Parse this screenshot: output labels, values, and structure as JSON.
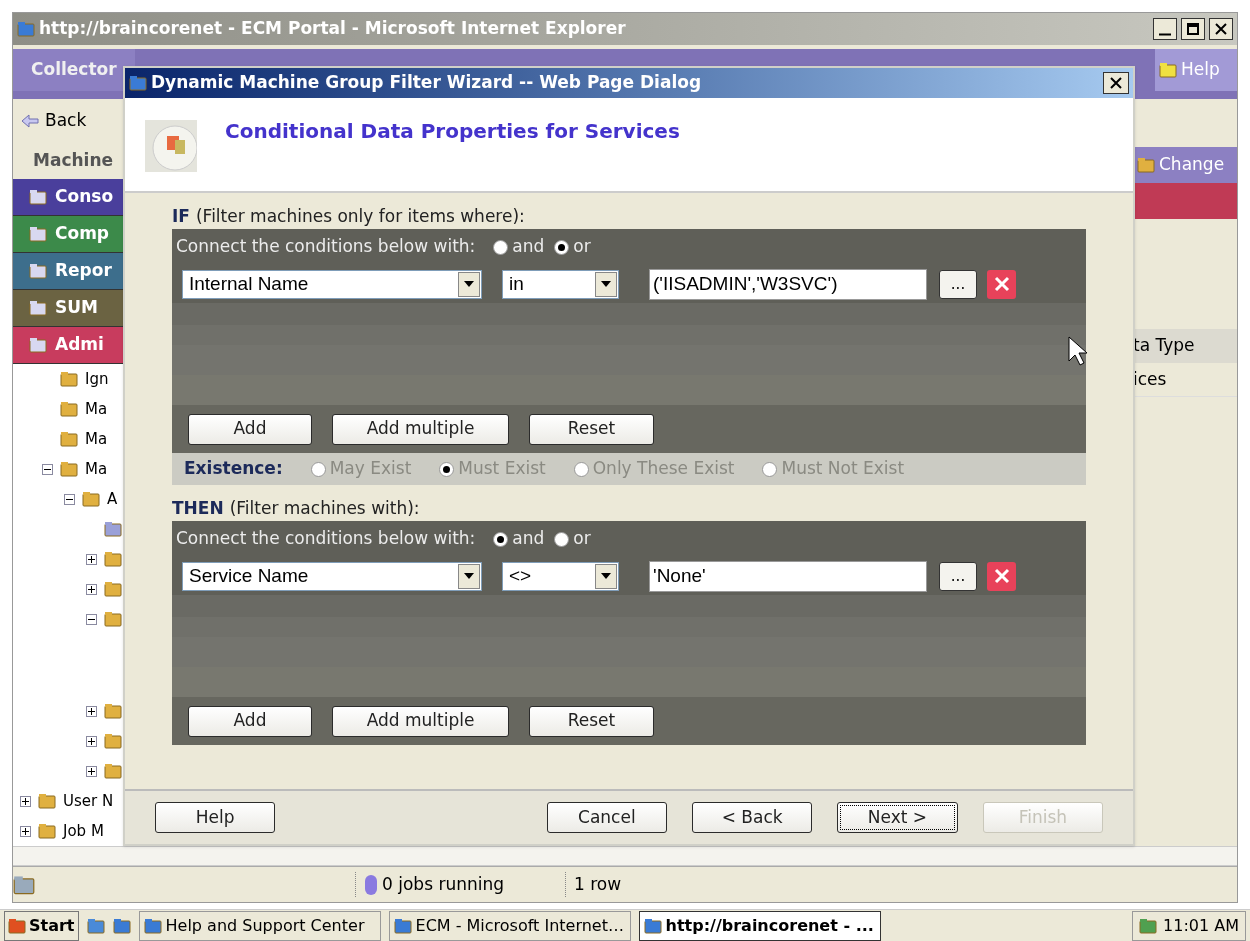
{
  "browser": {
    "title": "http://braincorenet - ECM Portal - Microsoft Internet Explorer"
  },
  "app": {
    "tab": "Collector",
    "help": "Help",
    "back": "Back",
    "section": "Machine",
    "nav": [
      {
        "label": "Conso",
        "color": "#4a3f9c"
      },
      {
        "label": "Comp",
        "color": "#3c8a4a"
      },
      {
        "label": "Repor",
        "color": "#3d6e8c"
      },
      {
        "label": "SUM",
        "color": "#6b6342"
      },
      {
        "label": "Admi",
        "color": "#c83c5e"
      }
    ],
    "tree": [
      {
        "label": "Ign"
      },
      {
        "label": "Ma"
      },
      {
        "label": "Ma"
      },
      {
        "label": "Ma",
        "expanded": true,
        "children": [
          {
            "label": "A",
            "expanded": true,
            "children": [
              {
                "kind": "machine"
              },
              {
                "expanded": false
              },
              {
                "expanded": false
              },
              {
                "expanded": true
              },
              {
                "expanded": false
              },
              {
                "expanded": false
              },
              {
                "expanded": false
              }
            ]
          }
        ]
      }
    ],
    "tree_roots": [
      {
        "label": "User N",
        "expanded": false
      },
      {
        "label": "Job M",
        "expanded": false
      }
    ],
    "change": "Change",
    "column_header": "ta Type",
    "cell": "ices"
  },
  "dialog": {
    "title": "Dynamic Machine Group Filter Wizard -- Web Page Dialog",
    "heading": "Conditional Data Properties for Services",
    "sections": [
      {
        "label": "IF",
        "hint": "(Filter machines only for items where):",
        "connect_label": "Connect the conditions below with:",
        "connectors": [
          {
            "label": "and",
            "selected": false
          },
          {
            "label": "or",
            "selected": true
          }
        ],
        "conditions": [
          {
            "field": "Internal Name",
            "operator": "in",
            "value": "('IISADMIN','W3SVC')",
            "browse": "..."
          }
        ],
        "buttons": [
          "Add",
          "Add multiple",
          "Reset"
        ],
        "existence": {
          "label": "Existence:",
          "options": [
            {
              "label": "May Exist",
              "selected": false
            },
            {
              "label": "Must Exist",
              "selected": true
            },
            {
              "label": "Only These Exist",
              "selected": false
            },
            {
              "label": "Must Not Exist",
              "selected": false
            }
          ]
        }
      },
      {
        "label": "THEN",
        "hint": "(Filter machines with):",
        "connect_label": "Connect the conditions below with:",
        "connectors": [
          {
            "label": "and",
            "selected": true
          },
          {
            "label": "or",
            "selected": false
          }
        ],
        "conditions": [
          {
            "field": "Service Name",
            "operator": "<>",
            "value": "'None'",
            "browse": "..."
          }
        ],
        "buttons": [
          "Add",
          "Add multiple",
          "Reset"
        ]
      }
    ],
    "footer": [
      {
        "label": "Help",
        "disabled": false,
        "focused": false
      },
      {
        "label": "Cancel",
        "disabled": false,
        "focused": false
      },
      {
        "label": "< Back",
        "disabled": false,
        "focused": false
      },
      {
        "label": "Next >",
        "disabled": false,
        "focused": true
      },
      {
        "label": "Finish",
        "disabled": true,
        "focused": false
      }
    ]
  },
  "status_bar": {
    "jobs": "0 jobs running",
    "rows": "1 row"
  },
  "taskbar": {
    "start": "Start",
    "tasks": [
      {
        "label": "Help and Support Center",
        "selected": false
      },
      {
        "label": "ECM - Microsoft Internet…",
        "selected": false
      },
      {
        "label": "http://braincorenet - ...",
        "selected": true
      }
    ],
    "clock": "11:01 AM"
  }
}
